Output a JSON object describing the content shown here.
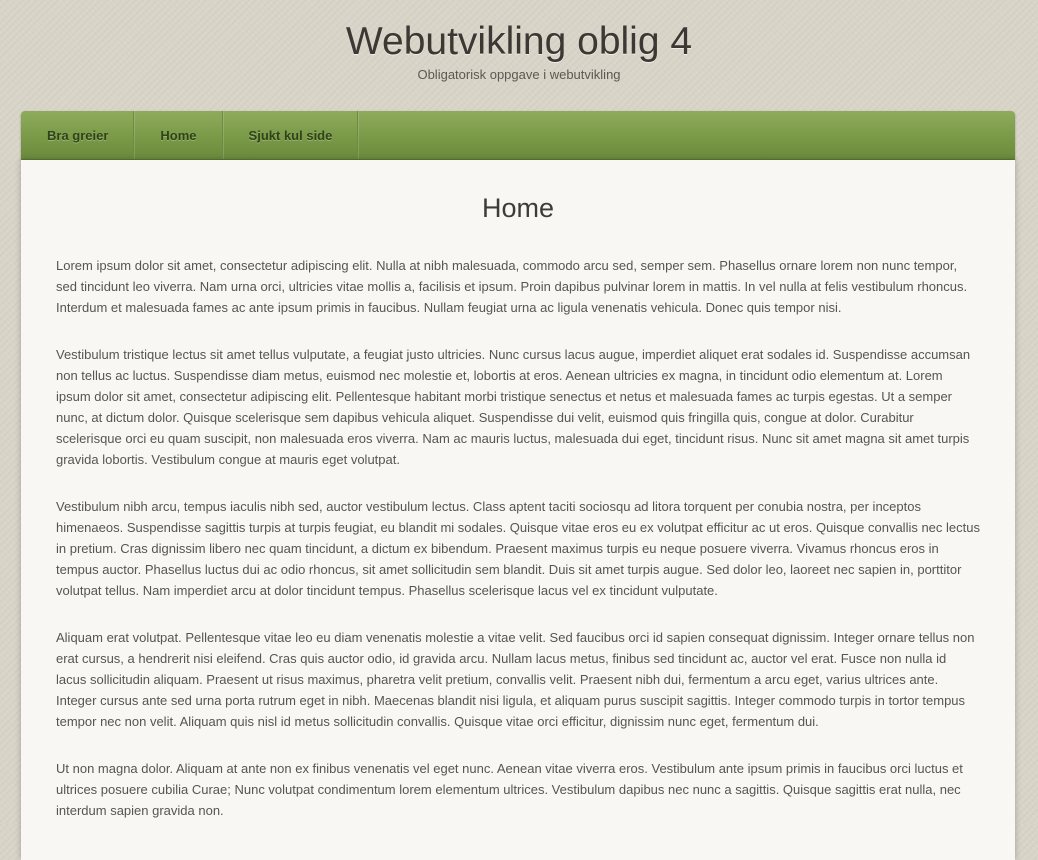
{
  "header": {
    "title": "Webutvikling oblig 4",
    "subtitle": "Obligatorisk oppgave i webutvikling"
  },
  "nav": {
    "items": [
      {
        "label": "Bra greier"
      },
      {
        "label": "Home"
      },
      {
        "label": "Sjukt kul side"
      }
    ]
  },
  "main": {
    "heading": "Home",
    "paragraphs": [
      "Lorem ipsum dolor sit amet, consectetur adipiscing elit. Nulla at nibh malesuada, commodo arcu sed, semper sem. Phasellus ornare lorem non nunc tempor, sed tincidunt leo viverra. Nam urna orci, ultricies vitae mollis a, facilisis et ipsum. Proin dapibus pulvinar lorem in mattis. In vel nulla at felis vestibulum rhoncus. Interdum et malesuada fames ac ante ipsum primis in faucibus. Nullam feugiat urna ac ligula venenatis vehicula. Donec quis tempor nisi.",
      "Vestibulum tristique lectus sit amet tellus vulputate, a feugiat justo ultricies. Nunc cursus lacus augue, imperdiet aliquet erat sodales id. Suspendisse accumsan non tellus ac luctus. Suspendisse diam metus, euismod nec molestie et, lobortis at eros. Aenean ultricies ex magna, in tincidunt odio elementum at. Lorem ipsum dolor sit amet, consectetur adipiscing elit. Pellentesque habitant morbi tristique senectus et netus et malesuada fames ac turpis egestas. Ut a semper nunc, at dictum dolor. Quisque scelerisque sem dapibus vehicula aliquet. Suspendisse dui velit, euismod quis fringilla quis, congue at dolor. Curabitur scelerisque orci eu quam suscipit, non malesuada eros viverra. Nam ac mauris luctus, malesuada dui eget, tincidunt risus. Nunc sit amet magna sit amet turpis gravida lobortis. Vestibulum congue at mauris eget volutpat.",
      "Vestibulum nibh arcu, tempus iaculis nibh sed, auctor vestibulum lectus. Class aptent taciti sociosqu ad litora torquent per conubia nostra, per inceptos himenaeos. Suspendisse sagittis turpis at turpis feugiat, eu blandit mi sodales. Quisque vitae eros eu ex volutpat efficitur ac ut eros. Quisque convallis nec lectus in pretium. Cras dignissim libero nec quam tincidunt, a dictum ex bibendum. Praesent maximus turpis eu neque posuere viverra. Vivamus rhoncus eros in tempus auctor. Phasellus luctus dui ac odio rhoncus, sit amet sollicitudin sem blandit. Duis sit amet turpis augue. Sed dolor leo, laoreet nec sapien in, porttitor volutpat tellus. Nam imperdiet arcu at dolor tincidunt tempus. Phasellus scelerisque lacus vel ex tincidunt vulputate.",
      "Aliquam erat volutpat. Pellentesque vitae leo eu diam venenatis molestie a vitae velit. Sed faucibus orci id sapien consequat dignissim. Integer ornare tellus non erat cursus, a hendrerit nisi eleifend. Cras quis auctor odio, id gravida arcu. Nullam lacus metus, finibus sed tincidunt ac, auctor vel erat. Fusce non nulla id lacus sollicitudin aliquam. Praesent ut risus maximus, pharetra velit pretium, convallis velit. Praesent nibh dui, fermentum a arcu eget, varius ultrices ante. Integer cursus ante sed urna porta rutrum eget in nibh. Maecenas blandit nisi ligula, et aliquam purus suscipit sagittis. Integer commodo turpis in tortor tempus tempor nec non velit. Aliquam quis nisl id metus sollicitudin convallis. Quisque vitae orci efficitur, dignissim nunc eget, fermentum dui.",
      "Ut non magna dolor. Aliquam at ante non ex finibus venenatis vel eget nunc. Aenean vitae viverra eros. Vestibulum ante ipsum primis in faucibus orci luctus et ultrices posuere cubilia Curae; Nunc volutpat condimentum lorem elementum ultrices. Vestibulum dapibus nec nunc a sagittis. Quisque sagittis erat nulla, nec interdum sapien gravida non."
    ]
  },
  "colors": {
    "nav_green": "#7a9a48",
    "nav_text": "#2f4218",
    "background": "#d9d4c8",
    "panel": "#f8f7f3"
  }
}
